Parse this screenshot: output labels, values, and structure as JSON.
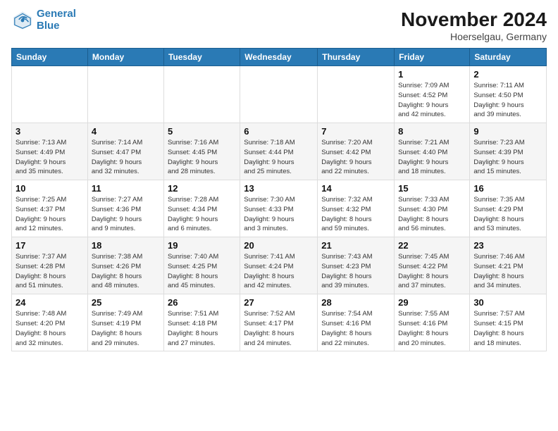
{
  "header": {
    "logo_line1": "General",
    "logo_line2": "Blue",
    "month": "November 2024",
    "location": "Hoerselgau, Germany"
  },
  "weekdays": [
    "Sunday",
    "Monday",
    "Tuesday",
    "Wednesday",
    "Thursday",
    "Friday",
    "Saturday"
  ],
  "weeks": [
    [
      {
        "day": "",
        "info": ""
      },
      {
        "day": "",
        "info": ""
      },
      {
        "day": "",
        "info": ""
      },
      {
        "day": "",
        "info": ""
      },
      {
        "day": "",
        "info": ""
      },
      {
        "day": "1",
        "info": "Sunrise: 7:09 AM\nSunset: 4:52 PM\nDaylight: 9 hours\nand 42 minutes."
      },
      {
        "day": "2",
        "info": "Sunrise: 7:11 AM\nSunset: 4:50 PM\nDaylight: 9 hours\nand 39 minutes."
      }
    ],
    [
      {
        "day": "3",
        "info": "Sunrise: 7:13 AM\nSunset: 4:49 PM\nDaylight: 9 hours\nand 35 minutes."
      },
      {
        "day": "4",
        "info": "Sunrise: 7:14 AM\nSunset: 4:47 PM\nDaylight: 9 hours\nand 32 minutes."
      },
      {
        "day": "5",
        "info": "Sunrise: 7:16 AM\nSunset: 4:45 PM\nDaylight: 9 hours\nand 28 minutes."
      },
      {
        "day": "6",
        "info": "Sunrise: 7:18 AM\nSunset: 4:44 PM\nDaylight: 9 hours\nand 25 minutes."
      },
      {
        "day": "7",
        "info": "Sunrise: 7:20 AM\nSunset: 4:42 PM\nDaylight: 9 hours\nand 22 minutes."
      },
      {
        "day": "8",
        "info": "Sunrise: 7:21 AM\nSunset: 4:40 PM\nDaylight: 9 hours\nand 18 minutes."
      },
      {
        "day": "9",
        "info": "Sunrise: 7:23 AM\nSunset: 4:39 PM\nDaylight: 9 hours\nand 15 minutes."
      }
    ],
    [
      {
        "day": "10",
        "info": "Sunrise: 7:25 AM\nSunset: 4:37 PM\nDaylight: 9 hours\nand 12 minutes."
      },
      {
        "day": "11",
        "info": "Sunrise: 7:27 AM\nSunset: 4:36 PM\nDaylight: 9 hours\nand 9 minutes."
      },
      {
        "day": "12",
        "info": "Sunrise: 7:28 AM\nSunset: 4:34 PM\nDaylight: 9 hours\nand 6 minutes."
      },
      {
        "day": "13",
        "info": "Sunrise: 7:30 AM\nSunset: 4:33 PM\nDaylight: 9 hours\nand 3 minutes."
      },
      {
        "day": "14",
        "info": "Sunrise: 7:32 AM\nSunset: 4:32 PM\nDaylight: 8 hours\nand 59 minutes."
      },
      {
        "day": "15",
        "info": "Sunrise: 7:33 AM\nSunset: 4:30 PM\nDaylight: 8 hours\nand 56 minutes."
      },
      {
        "day": "16",
        "info": "Sunrise: 7:35 AM\nSunset: 4:29 PM\nDaylight: 8 hours\nand 53 minutes."
      }
    ],
    [
      {
        "day": "17",
        "info": "Sunrise: 7:37 AM\nSunset: 4:28 PM\nDaylight: 8 hours\nand 51 minutes."
      },
      {
        "day": "18",
        "info": "Sunrise: 7:38 AM\nSunset: 4:26 PM\nDaylight: 8 hours\nand 48 minutes."
      },
      {
        "day": "19",
        "info": "Sunrise: 7:40 AM\nSunset: 4:25 PM\nDaylight: 8 hours\nand 45 minutes."
      },
      {
        "day": "20",
        "info": "Sunrise: 7:41 AM\nSunset: 4:24 PM\nDaylight: 8 hours\nand 42 minutes."
      },
      {
        "day": "21",
        "info": "Sunrise: 7:43 AM\nSunset: 4:23 PM\nDaylight: 8 hours\nand 39 minutes."
      },
      {
        "day": "22",
        "info": "Sunrise: 7:45 AM\nSunset: 4:22 PM\nDaylight: 8 hours\nand 37 minutes."
      },
      {
        "day": "23",
        "info": "Sunrise: 7:46 AM\nSunset: 4:21 PM\nDaylight: 8 hours\nand 34 minutes."
      }
    ],
    [
      {
        "day": "24",
        "info": "Sunrise: 7:48 AM\nSunset: 4:20 PM\nDaylight: 8 hours\nand 32 minutes."
      },
      {
        "day": "25",
        "info": "Sunrise: 7:49 AM\nSunset: 4:19 PM\nDaylight: 8 hours\nand 29 minutes."
      },
      {
        "day": "26",
        "info": "Sunrise: 7:51 AM\nSunset: 4:18 PM\nDaylight: 8 hours\nand 27 minutes."
      },
      {
        "day": "27",
        "info": "Sunrise: 7:52 AM\nSunset: 4:17 PM\nDaylight: 8 hours\nand 24 minutes."
      },
      {
        "day": "28",
        "info": "Sunrise: 7:54 AM\nSunset: 4:16 PM\nDaylight: 8 hours\nand 22 minutes."
      },
      {
        "day": "29",
        "info": "Sunrise: 7:55 AM\nSunset: 4:16 PM\nDaylight: 8 hours\nand 20 minutes."
      },
      {
        "day": "30",
        "info": "Sunrise: 7:57 AM\nSunset: 4:15 PM\nDaylight: 8 hours\nand 18 minutes."
      }
    ]
  ]
}
